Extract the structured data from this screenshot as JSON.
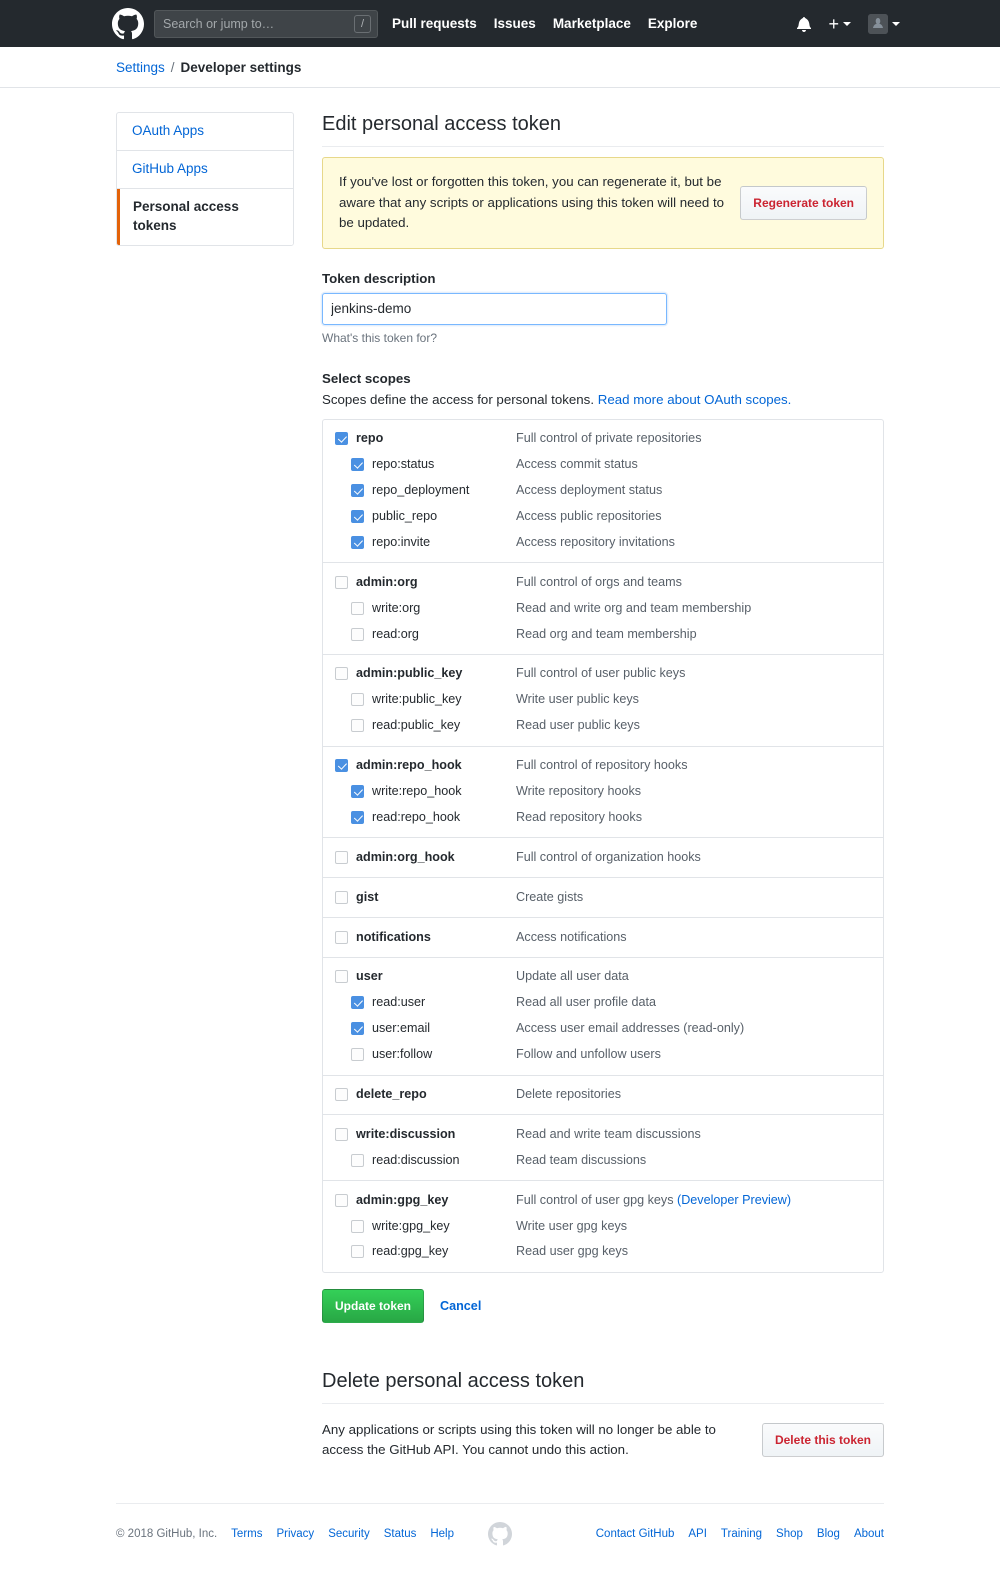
{
  "header": {
    "logo_icon": "github-mark-icon",
    "search": {
      "placeholder": "Search or jump to…",
      "value": "",
      "shortcut_key": "/"
    },
    "nav": [
      {
        "label": "Pull requests"
      },
      {
        "label": "Issues"
      },
      {
        "label": "Marketplace"
      },
      {
        "label": "Explore"
      }
    ],
    "right": {
      "notifications_icon": "bell-icon",
      "create_new_icon": "plus-icon",
      "create_new_caret": "chevron-down-icon",
      "avatar_icon": "user-avatar",
      "avatar_caret": "chevron-down-icon"
    }
  },
  "breadcrumb": {
    "root_label": "Settings",
    "separator": "/",
    "current_label": "Developer settings"
  },
  "sidebar": {
    "items": [
      {
        "label": "OAuth Apps",
        "selected": false
      },
      {
        "label": "GitHub Apps",
        "selected": false
      },
      {
        "label": "Personal access tokens",
        "selected": true
      }
    ]
  },
  "main": {
    "title": "Edit personal access token",
    "flash": {
      "message": "If you've lost or forgotten this token, you can regenerate it, but be aware that any scripts or applications using this token will need to be updated.",
      "button_label": "Regenerate token"
    },
    "token_description": {
      "label": "Token description",
      "value": "jenkins-demo",
      "placeholder": "",
      "note": "What's this token for?"
    },
    "scopes": {
      "heading": "Select scopes",
      "description_prefix": "Scopes define the access for personal tokens.",
      "description_link": "Read more about OAuth scopes.",
      "groups": [
        {
          "rows": [
            {
              "name": "repo",
              "desc": "Full control of private repositories",
              "checked": true,
              "child": false
            },
            {
              "name": "repo:status",
              "desc": "Access commit status",
              "checked": true,
              "child": true
            },
            {
              "name": "repo_deployment",
              "desc": "Access deployment status",
              "checked": true,
              "child": true
            },
            {
              "name": "public_repo",
              "desc": "Access public repositories",
              "checked": true,
              "child": true
            },
            {
              "name": "repo:invite",
              "desc": "Access repository invitations",
              "checked": true,
              "child": true
            }
          ]
        },
        {
          "rows": [
            {
              "name": "admin:org",
              "desc": "Full control of orgs and teams",
              "checked": false,
              "child": false
            },
            {
              "name": "write:org",
              "desc": "Read and write org and team membership",
              "checked": false,
              "child": true
            },
            {
              "name": "read:org",
              "desc": "Read org and team membership",
              "checked": false,
              "child": true
            }
          ]
        },
        {
          "rows": [
            {
              "name": "admin:public_key",
              "desc": "Full control of user public keys",
              "checked": false,
              "child": false
            },
            {
              "name": "write:public_key",
              "desc": "Write user public keys",
              "checked": false,
              "child": true
            },
            {
              "name": "read:public_key",
              "desc": "Read user public keys",
              "checked": false,
              "child": true
            }
          ]
        },
        {
          "rows": [
            {
              "name": "admin:repo_hook",
              "desc": "Full control of repository hooks",
              "checked": true,
              "child": false
            },
            {
              "name": "write:repo_hook",
              "desc": "Write repository hooks",
              "checked": true,
              "child": true
            },
            {
              "name": "read:repo_hook",
              "desc": "Read repository hooks",
              "checked": true,
              "child": true
            }
          ]
        },
        {
          "rows": [
            {
              "name": "admin:org_hook",
              "desc": "Full control of organization hooks",
              "checked": false,
              "child": false
            }
          ]
        },
        {
          "rows": [
            {
              "name": "gist",
              "desc": "Create gists",
              "checked": false,
              "child": false
            }
          ]
        },
        {
          "rows": [
            {
              "name": "notifications",
              "desc": "Access notifications",
              "checked": false,
              "child": false
            }
          ]
        },
        {
          "rows": [
            {
              "name": "user",
              "desc": "Update all user data",
              "checked": false,
              "child": false
            },
            {
              "name": "read:user",
              "desc": "Read all user profile data",
              "checked": true,
              "child": true
            },
            {
              "name": "user:email",
              "desc": "Access user email addresses (read-only)",
              "checked": true,
              "child": true
            },
            {
              "name": "user:follow",
              "desc": "Follow and unfollow users",
              "checked": false,
              "child": true
            }
          ]
        },
        {
          "rows": [
            {
              "name": "delete_repo",
              "desc": "Delete repositories",
              "checked": false,
              "child": false
            }
          ]
        },
        {
          "rows": [
            {
              "name": "write:discussion",
              "desc": "Read and write team discussions",
              "checked": false,
              "child": false
            },
            {
              "name": "read:discussion",
              "desc": "Read team discussions",
              "checked": false,
              "child": true
            }
          ]
        },
        {
          "rows": [
            {
              "name": "admin:gpg_key",
              "desc": "Full control of user gpg keys",
              "desc_link": "(Developer Preview)",
              "checked": false,
              "child": false
            },
            {
              "name": "write:gpg_key",
              "desc": "Write user gpg keys",
              "checked": false,
              "child": true
            },
            {
              "name": "read:gpg_key",
              "desc": "Read user gpg keys",
              "checked": false,
              "child": true
            }
          ]
        }
      ]
    },
    "actions": {
      "submit_label": "Update token",
      "cancel_label": "Cancel"
    },
    "delete_section": {
      "title": "Delete personal access token",
      "text": "Any applications or scripts using this token will no longer be able to access the GitHub API. You cannot undo this action.",
      "button_label": "Delete this token"
    }
  },
  "footer": {
    "copyright": "© 2018 GitHub, Inc.",
    "left_links": [
      {
        "label": "Terms"
      },
      {
        "label": "Privacy"
      },
      {
        "label": "Security"
      },
      {
        "label": "Status"
      },
      {
        "label": "Help"
      }
    ],
    "center_icon": "github-mark-icon",
    "right_links": [
      {
        "label": "Contact GitHub"
      },
      {
        "label": "API"
      },
      {
        "label": "Training"
      },
      {
        "label": "Shop"
      },
      {
        "label": "Blog"
      },
      {
        "label": "About"
      }
    ]
  }
}
